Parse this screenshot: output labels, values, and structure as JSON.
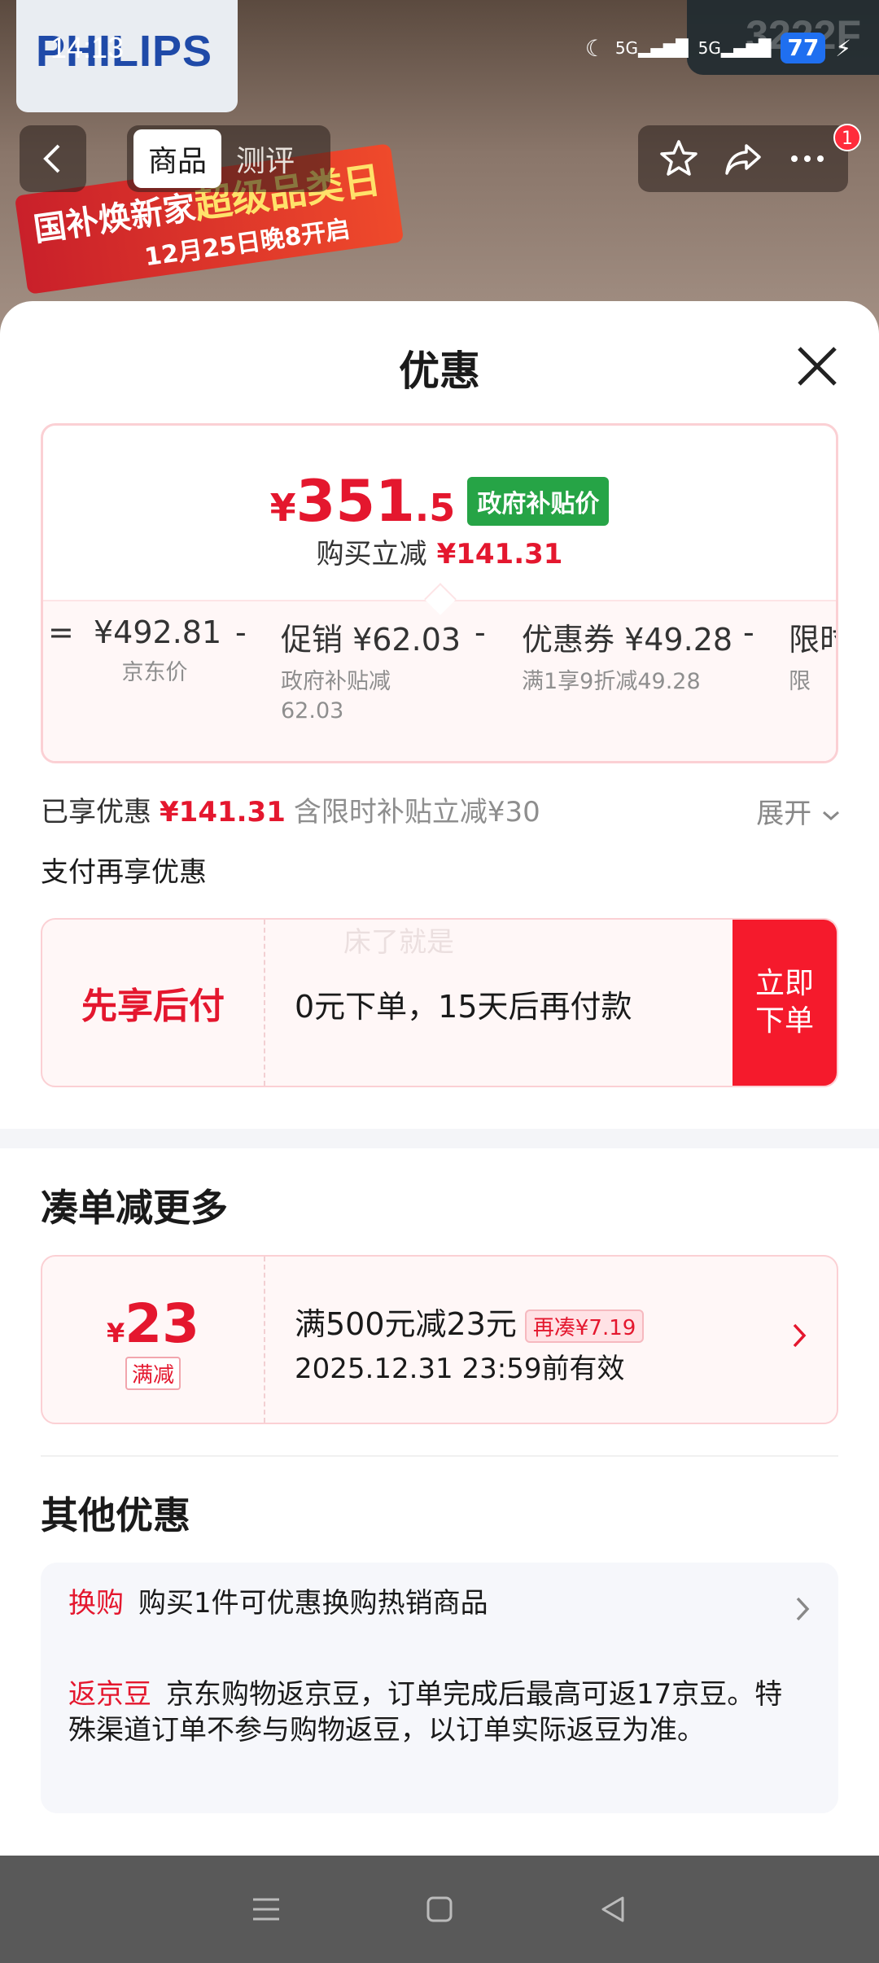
{
  "status_bar": {
    "time": "14:13",
    "battery": "77",
    "network1": "5G",
    "network2": "5G"
  },
  "background": {
    "brand": "PHILIPS",
    "corner_text": "3222F",
    "banner_line1_a": "国补焕新家",
    "banner_line1_b": "超级品类日",
    "banner_line2": "12月25日晚8开启"
  },
  "top_nav": {
    "tabs": [
      "商品",
      "测评"
    ],
    "badge_count": "1"
  },
  "sheet": {
    "title": "优惠",
    "price": {
      "currency": "¥",
      "integer": "351",
      "decimal": ".5",
      "tag": "政府补贴价"
    },
    "save": {
      "label": "购买立减",
      "amount": "¥141.31"
    },
    "breakdown": [
      {
        "value": "¥492.81",
        "sub": "京东价"
      },
      {
        "value": "促销 ¥62.03",
        "sub": "政府补贴减\n62.03"
      },
      {
        "value": "优惠券 ¥49.28",
        "sub": "满1享9折减49.28"
      },
      {
        "value": "限时",
        "sub": "限"
      }
    ],
    "operators": {
      "eq": "=",
      "minus": "-"
    },
    "enjoyed": {
      "label": "已享优惠",
      "amount": "¥141.31",
      "note": "含限时补贴立减¥30",
      "expand": "展开"
    },
    "pay_more": "支付再享优惠",
    "bnpl": {
      "left": "先享后付",
      "main": "0元下单，15天后再付款",
      "ghost": "床了就是",
      "button": "立即\n下单"
    }
  },
  "bundle": {
    "title": "凑单减更多",
    "coupon": {
      "currency": "¥",
      "amount": "23",
      "tag": "满减",
      "title": "满500元减23元",
      "pill": "再凑¥7.19",
      "date": "2025.12.31 23:59前有效"
    }
  },
  "other": {
    "title": "其他优惠",
    "items": [
      {
        "label": "换购",
        "text": "购买1件可优惠换购热销商品"
      },
      {
        "label": "返京豆",
        "text": "京东购物返京豆，订单完成后最高可返17京豆。特殊渠道订单不参与购物返豆，以订单实际返豆为准。"
      }
    ]
  },
  "colors": {
    "accent": "#e4172e",
    "green_tag": "#26a446",
    "bnpl_button": "#f51a2c"
  }
}
